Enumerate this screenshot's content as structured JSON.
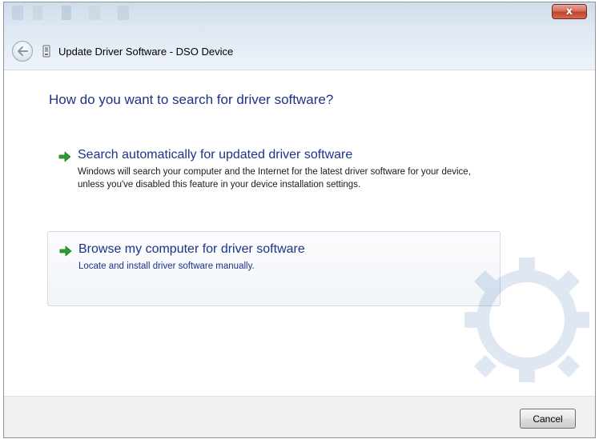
{
  "window": {
    "title": "Update Driver Software - DSO Device",
    "close_symbol": "x",
    "icons": {
      "back": "back-arrow-icon",
      "app": "device-icon",
      "close": "close-icon"
    }
  },
  "content": {
    "heading": "How do you want to search for driver software?",
    "options": [
      {
        "title": "Search automatically for updated driver software",
        "description": "Windows will search your computer and the Internet for the latest driver software for your device, unless you've disabled this feature in your device installation settings.",
        "icon": "green-arrow-icon"
      },
      {
        "title": "Browse my computer for driver software",
        "description": "Locate and install driver software manually.",
        "icon": "green-arrow-icon"
      }
    ]
  },
  "footer": {
    "cancel_label": "Cancel"
  },
  "colors": {
    "link_blue": "#1e3287",
    "arrow_green": "#2e9b2e",
    "close_red": "#c2402c"
  }
}
